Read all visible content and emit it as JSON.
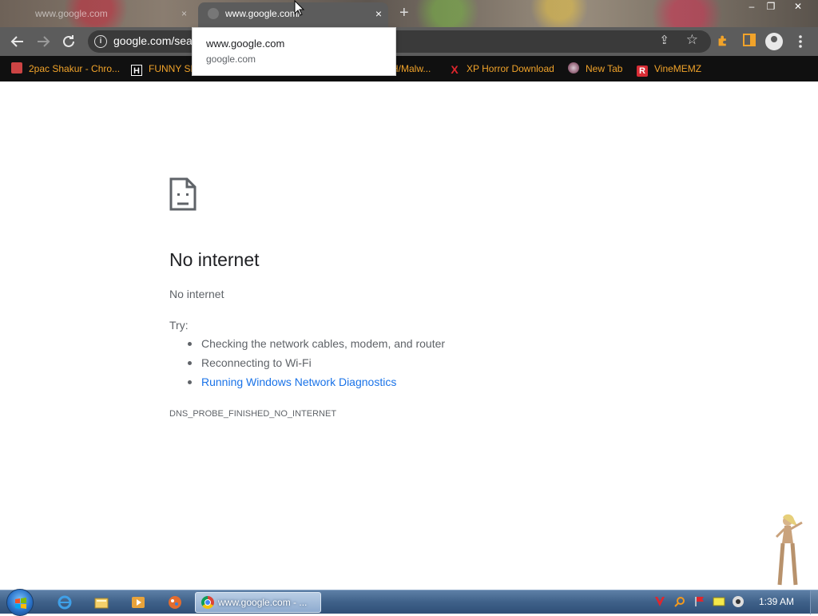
{
  "browser": {
    "background_tab": {
      "title": "www.google.com",
      "close": "×"
    },
    "active_tab": {
      "title": "www.google.com/",
      "close": "×"
    },
    "new_tab": "+",
    "window_controls": [
      "‒",
      "❐",
      "✕"
    ],
    "omnibox": {
      "url": "google.com/sea"
    },
    "tooltip": {
      "line1": "www.google.com",
      "line2": "google.com"
    }
  },
  "bookmarks": [
    {
      "label": "2pac Shakur - Chro...",
      "icon": "bookmark-favicon"
    },
    {
      "label": "FUNNY SH",
      "icon": "h-favicon"
    },
    {
      "label": "H/Malw...",
      "icon": "folder-bookmark"
    },
    {
      "label": "XP Horror Download",
      "icon": "x-favicon"
    },
    {
      "label": "New Tab",
      "icon": "globe-favicon"
    },
    {
      "label": "VineMEMZ",
      "icon": "r-favicon"
    }
  ],
  "error_page": {
    "title": "No internet",
    "subtitle": "No internet",
    "try_label": "Try:",
    "suggestions": [
      "Checking the network cables, modem, and router",
      "Reconnecting to Wi-Fi",
      "Running Windows Network Diagnostics"
    ],
    "error_code": "DNS_PROBE_FINISHED_NO_INTERNET"
  },
  "taskbar": {
    "task_label": "www.google.com - ...",
    "clock": "1:39 AM"
  },
  "colors": {
    "bookmark_text": "#f1a32a",
    "link_blue": "#1a73e8",
    "toolbar": "#5c5c5c"
  }
}
